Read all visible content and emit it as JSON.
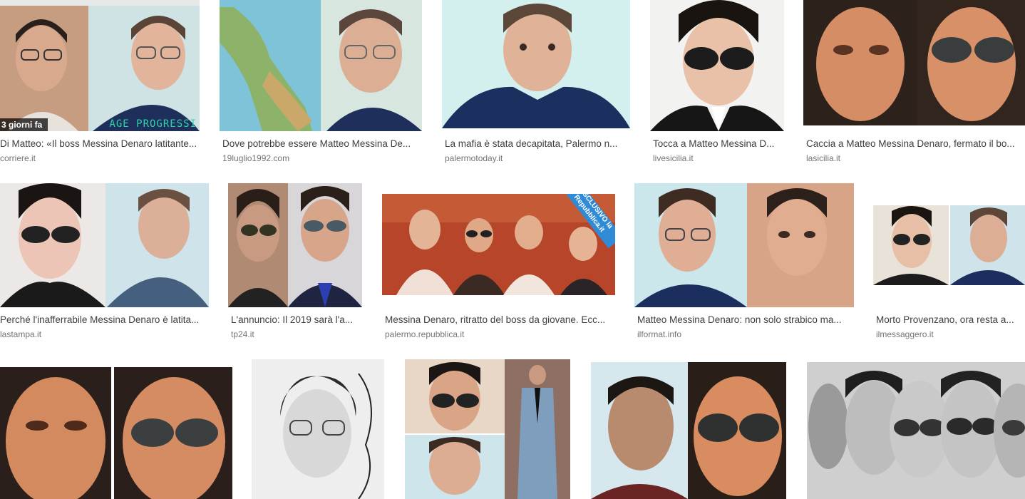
{
  "results": [
    {
      "caption": "Di Matteo: «Il boss Messina Denaro latitante...",
      "source": "corriere.it",
      "badge": "3 giorni fa",
      "overlay": "AGE  PROGRESSI"
    },
    {
      "caption": "Dove potrebbe essere Matteo Messina De...",
      "source": "19luglio1992.com"
    },
    {
      "caption": "La mafia è stata decapitata, Palermo n...",
      "source": "palermotoday.it"
    },
    {
      "caption": "Tocca a Matteo Messina D...",
      "source": "livesicilia.it"
    },
    {
      "caption": "Caccia a Matteo Messina Denaro, fermato il bo...",
      "source": "lasicilia.it"
    },
    {
      "caption": "Perché l'inafferrabile Messina Denaro è latita...",
      "source": "lastampa.it"
    },
    {
      "caption": "L'annuncio: Il 2019 sarà l'a...",
      "source": "tp24.it"
    },
    {
      "caption": "Messina Denaro, ritratto del boss da giovane. Ecc...",
      "source": "palermo.repubblica.it",
      "ribbon": "ESCLUSIVO la Repubblica.it"
    },
    {
      "caption": "Matteo Messina Denaro: non solo strabico ma...",
      "source": "ilformat.info"
    },
    {
      "caption": "Morto Provenzano, ora resta a...",
      "source": "ilmessaggero.it"
    },
    {
      "caption": "",
      "source": ""
    },
    {
      "caption": "",
      "source": ""
    },
    {
      "caption": "",
      "source": ""
    },
    {
      "caption": "",
      "source": ""
    },
    {
      "caption": "",
      "source": ""
    }
  ],
  "icons": {
    "face": "face-photo-icon",
    "sunglasses": "sunglasses-icon"
  }
}
